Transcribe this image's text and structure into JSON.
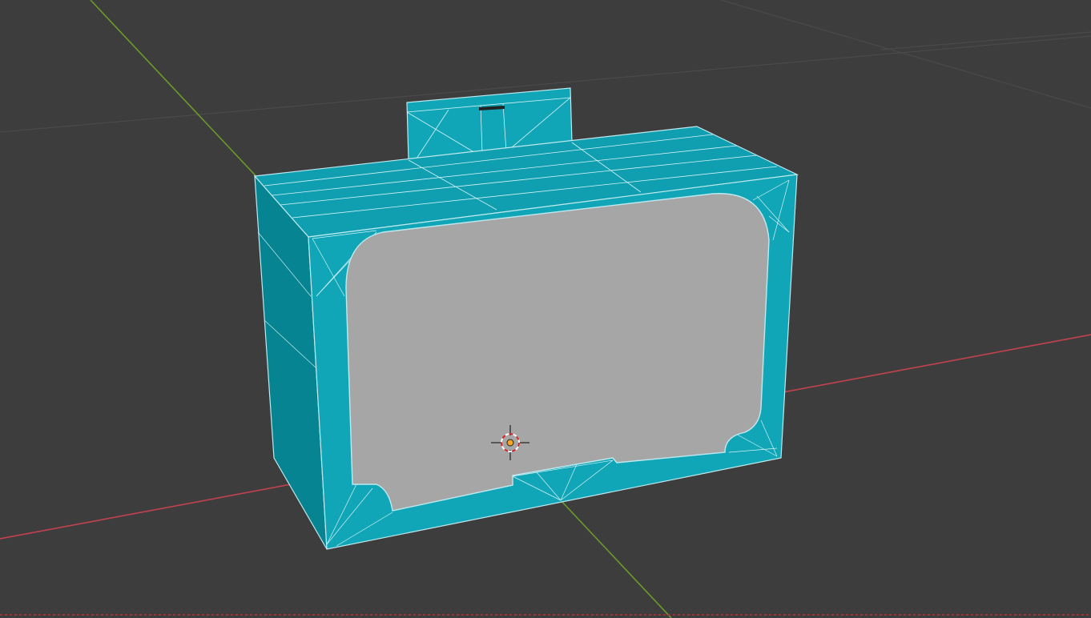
{
  "viewport": {
    "mode": "edit",
    "shading": "solid",
    "overlay": "wireframe",
    "background_color": "#3d3d3d",
    "grid_line_color": "#4a4a4a",
    "x_axis_color": "#c2424f",
    "y_axis_color": "#6b9a2a"
  },
  "object": {
    "type": "box-with-window",
    "body_color": "#0fa3b4",
    "side_color": "#08848f",
    "window_color": "#a8a8a8",
    "edge_color": "#bfe9ee"
  },
  "cursor": {
    "name": "3d-cursor",
    "ring_colors": [
      "#ffffff",
      "#d0262a"
    ],
    "origin_color": "#f5a623"
  }
}
